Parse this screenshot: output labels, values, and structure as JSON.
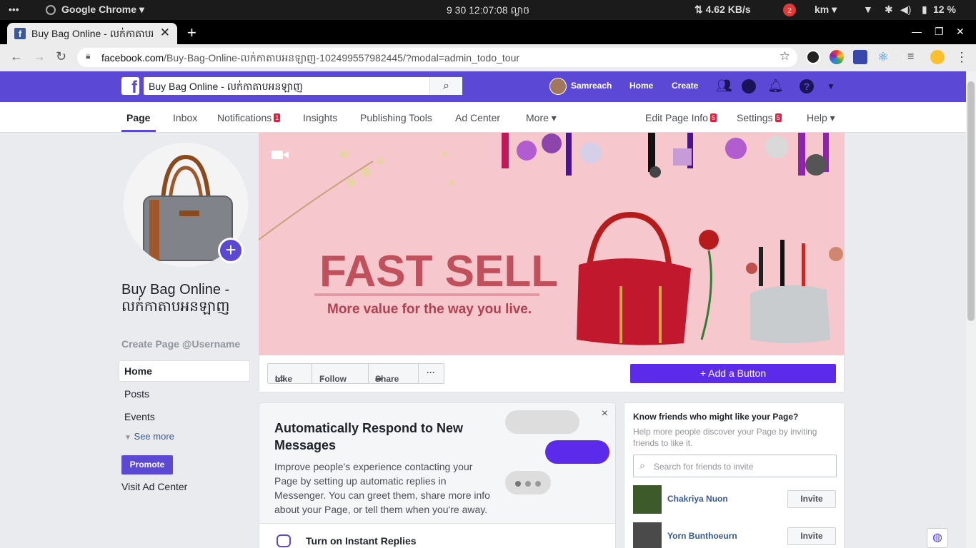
{
  "os": {
    "menu": "•••",
    "app": "Google Chrome ▾",
    "clock": "9 30 12:07:08 ល្ងាច",
    "net": "⇅ 4.62 KB/s",
    "notif_count": "2",
    "lang": "km ▾",
    "battery": "12 %"
  },
  "browser": {
    "tab_title": "Buy Bag Online - លក់កាតាបអនឡាញ",
    "url_host": "facebook.com",
    "url_path": "/Buy-Bag-Online-លក់កាតាបអនឡាញ-102499557982445/?modal=admin_todo_tour"
  },
  "fb": {
    "search_value": "Buy Bag Online - លក់កាតាបអនឡាញ",
    "user": "Samreach",
    "nav_home": "Home",
    "nav_create": "Create"
  },
  "page_tabs": [
    {
      "label": "Page"
    },
    {
      "label": "Inbox"
    },
    {
      "label": "Notifications",
      "badge": "1"
    },
    {
      "label": "Insights"
    },
    {
      "label": "Publishing Tools"
    },
    {
      "label": "Ad Center"
    },
    {
      "label": "More ▾"
    },
    {
      "label": "Edit Page Info",
      "badge": "5"
    },
    {
      "label": "Settings",
      "badge": "5"
    },
    {
      "label": "Help ▾"
    }
  ],
  "left": {
    "page_name": "Buy Bag Online - លក់កាតាបអនឡាញ",
    "username": "Create Page @Username",
    "nav": [
      "Home",
      "Posts",
      "Events"
    ],
    "see_more": "See more",
    "promote": "Promote",
    "visit_ad": "Visit Ad Center"
  },
  "cover": {
    "headline": "FAST SELL",
    "tagline": "More value for the way you live."
  },
  "actions": {
    "like": "Like",
    "follow": "Follow",
    "share": "Share",
    "more": "···",
    "add_button": "Add a Button"
  },
  "auto_respond": {
    "title": "Automatically Respond to New Messages",
    "desc": "Improve people's experience contacting your Page by setting up automatic replies in Messenger. You can greet them, share more info about your Page, or tell them when you're away.",
    "close": "×",
    "footer": "Turn on Instant Replies"
  },
  "invite": {
    "heading": "Know friends who might like your Page?",
    "sub": "Help more people discover your Page by inviting friends to like it.",
    "placeholder": "Search for friends to invite",
    "friends": [
      {
        "name": "Chakriya Nuon",
        "button": "Invite"
      },
      {
        "name": "Yorn Bunthoeurn",
        "button": "Invite"
      }
    ]
  },
  "colors": {
    "brand": "#5b48d4",
    "button": "#5b2aeb",
    "cover_bg": "#f6c7cc",
    "headline": "#c0505c"
  }
}
